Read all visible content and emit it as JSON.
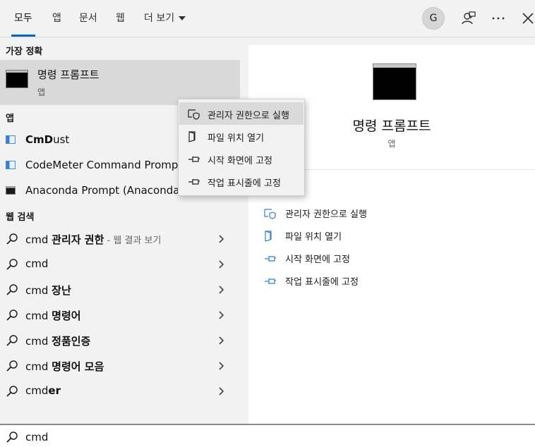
{
  "header": {
    "tabs": [
      {
        "label": "모두"
      },
      {
        "label": "앱"
      },
      {
        "label": "문서"
      },
      {
        "label": "웹"
      },
      {
        "label": "더 보기"
      }
    ],
    "avatar_initial": "G"
  },
  "left": {
    "best_match_label": "가장 정확",
    "best_match": {
      "title": "명령 프롬프트",
      "subtitle": "앱"
    },
    "apps_label": "앱",
    "apps": [
      {
        "bold": "CmD",
        "rest": "ust",
        "icon": "app-window-icon"
      },
      {
        "text": "CodeMeter Command Prompt",
        "icon": "app-window-icon"
      },
      {
        "text": "Anaconda Prompt (Anaconda3)",
        "icon": "terminal-icon"
      }
    ],
    "web_label": "웹 검색",
    "web_results": [
      {
        "prefix": "cmd ",
        "bold": "관리자 권한",
        "suffix": " - 웹 결과 보기"
      },
      {
        "prefix": "cmd",
        "bold": "",
        "suffix": ""
      },
      {
        "prefix": "cmd ",
        "bold": "장난",
        "suffix": ""
      },
      {
        "prefix": "cmd ",
        "bold": "명령어",
        "suffix": ""
      },
      {
        "prefix": "cmd ",
        "bold": "정품인증",
        "suffix": ""
      },
      {
        "prefix": "cmd ",
        "bold": "명령어 모음",
        "suffix": ""
      },
      {
        "prefix": "cmd",
        "bold": "er",
        "suffix": ""
      }
    ]
  },
  "context_menu": {
    "items": [
      {
        "label": "관리자 권한으로 실행",
        "icon": "shield-icon"
      },
      {
        "label": "파일 위치 열기",
        "icon": "file-location-icon"
      },
      {
        "label": "시작 화면에 고정",
        "icon": "pin-icon"
      },
      {
        "label": "작업 표시줄에 고정",
        "icon": "pin-icon"
      }
    ]
  },
  "preview": {
    "title": "명령 프롬프트",
    "subtitle": "앱",
    "actions": [
      {
        "label": "관리자 권한으로 실행",
        "icon": "shield-icon"
      },
      {
        "label": "파일 위치 열기",
        "icon": "file-location-icon"
      },
      {
        "label": "시작 화면에 고정",
        "icon": "pin-icon"
      },
      {
        "label": "작업 표시줄에 고정",
        "icon": "pin-icon"
      }
    ]
  },
  "search": {
    "value": "cmd"
  },
  "colors": {
    "accent": "#0067c0",
    "preview_bg": "#ffffff",
    "panel_bg": "#f2f2f2",
    "selected_bg": "#d9d9d9"
  }
}
